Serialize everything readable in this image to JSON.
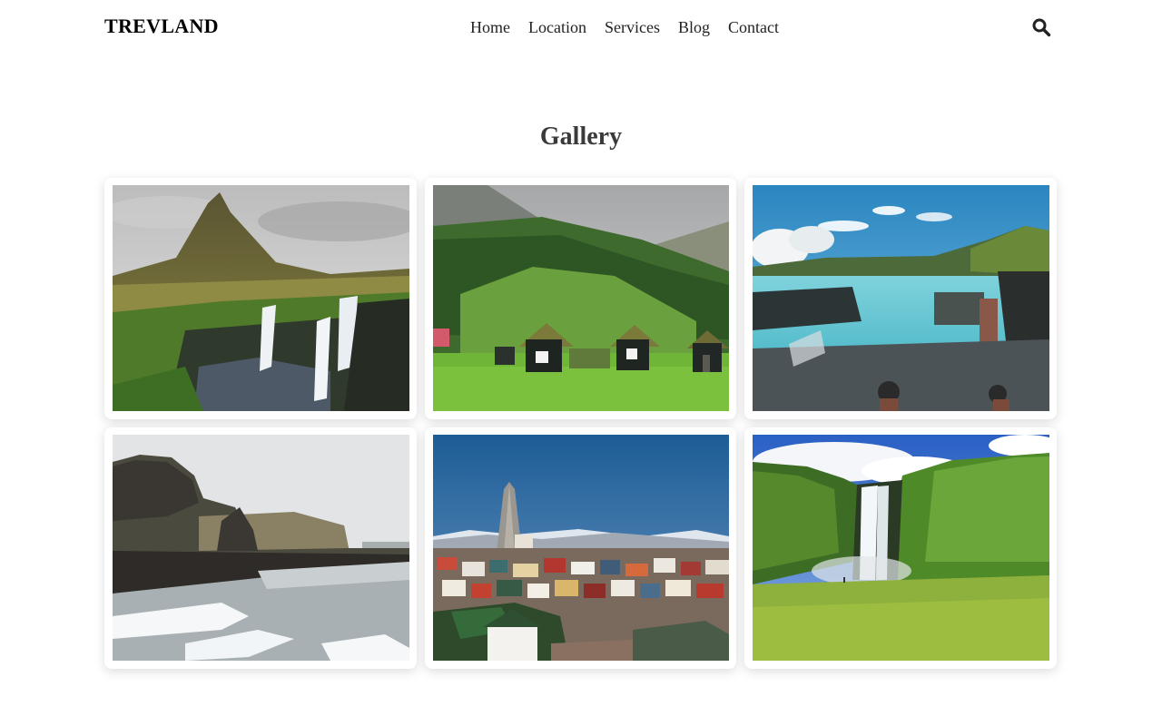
{
  "brand": "TREVLAND",
  "nav": {
    "links": [
      "Home",
      "Location",
      "Services",
      "Blog",
      "Contact"
    ],
    "search_icon": "search-icon"
  },
  "gallery": {
    "title": "Gallery",
    "photos": [
      {
        "subject": "mountain-waterfall-photo"
      },
      {
        "subject": "turf-houses-photo"
      },
      {
        "subject": "geothermal-lagoon-photo"
      },
      {
        "subject": "black-sand-beach-photo"
      },
      {
        "subject": "city-church-skyline-photo"
      },
      {
        "subject": "waterfall-valley-photo"
      }
    ]
  },
  "colors": {
    "background": "#ffffff",
    "title": "#3a3a3a",
    "text": "#222222"
  }
}
